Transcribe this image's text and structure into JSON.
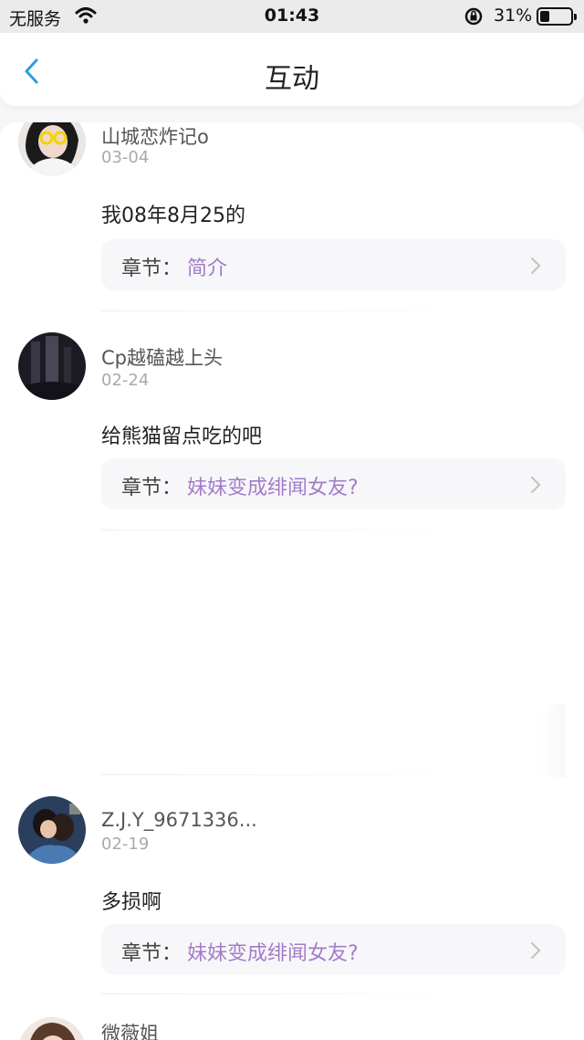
{
  "status_bar": {
    "carrier": "无服务",
    "time": "01:43",
    "battery_percent": "31%",
    "battery_level": 0.31
  },
  "nav": {
    "title": "互动",
    "accent_color": "#2e9bdf"
  },
  "comments": [
    {
      "username": "山城恋炸记o",
      "date": "03-04",
      "text": "我08年8月25的",
      "chapter_label": "章节：",
      "chapter_name": "简介"
    },
    {
      "username": "Cp越磕越上头",
      "date": "02-24",
      "text": "给熊猫留点吃的吧",
      "chapter_label": "章节：",
      "chapter_name": "妹妹变成绯闻女友?"
    },
    {
      "username": "Z.J.Y_9671336...",
      "date": "02-19",
      "text": "多损啊",
      "chapter_label": "章节：",
      "chapter_name": "妹妹变成绯闻女友?"
    },
    {
      "username": "微薇姐"
    }
  ],
  "colors": {
    "chapter_name": "#a37cc9",
    "date": "#aaaaaa"
  }
}
